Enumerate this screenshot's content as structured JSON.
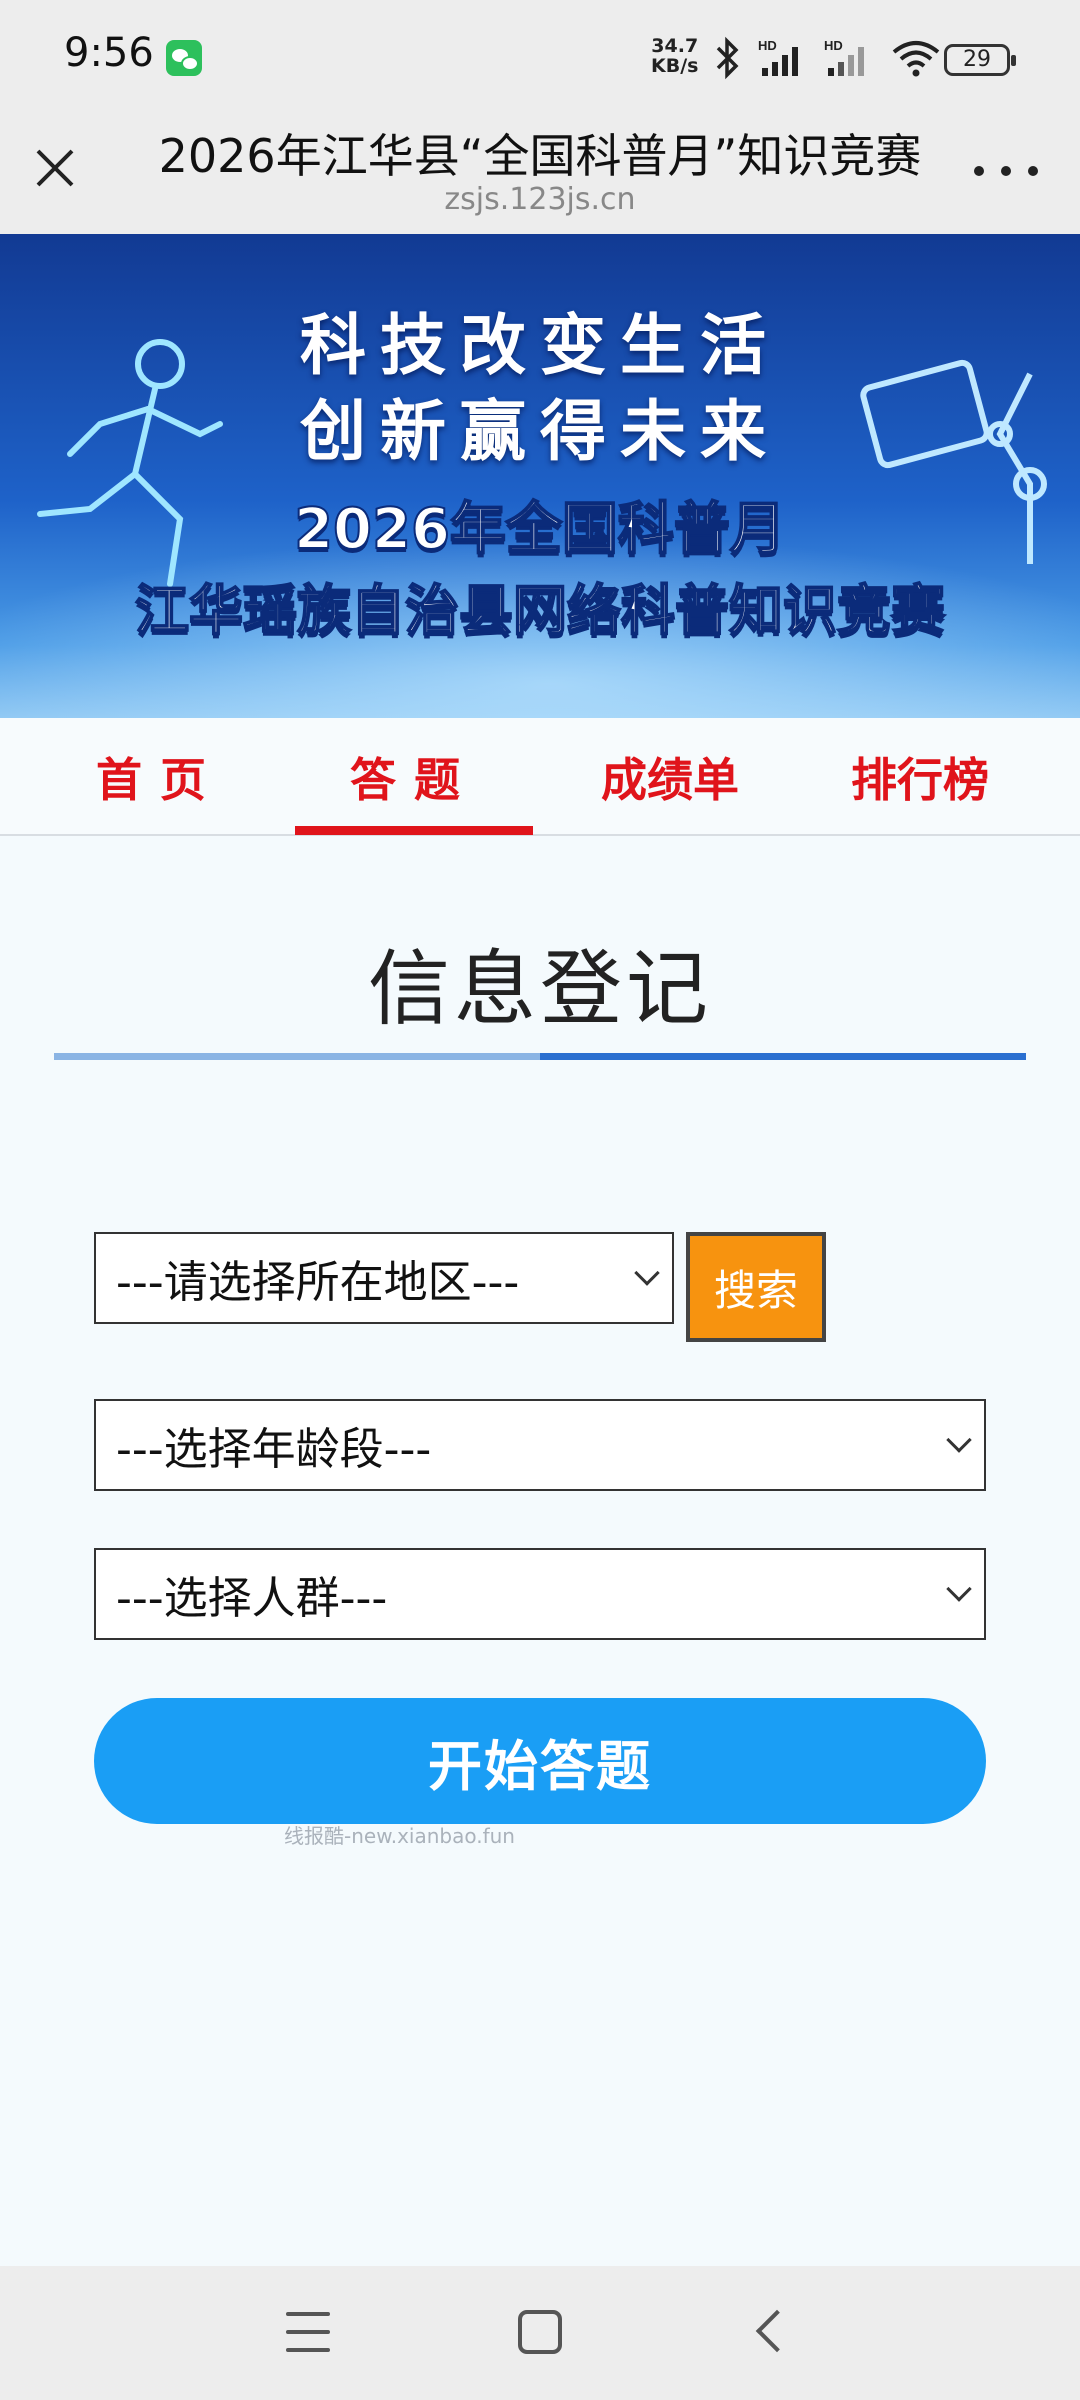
{
  "status_bar": {
    "time": "9:56",
    "net_speed_value": "34.7",
    "net_speed_unit": "KB/s",
    "battery": "29",
    "icons": [
      "wechat-icon",
      "bluetooth-icon",
      "signal-hd-icon",
      "signal-hd-icon",
      "wifi-icon",
      "battery-icon"
    ]
  },
  "title_bar": {
    "title": "2026年江华县“全国科普月”知识竞赛",
    "url": "zsjs.123js.cn",
    "close_icon": "close-icon",
    "more_icon": "more-icon"
  },
  "banner": {
    "slogan_line1": "科技改变生活",
    "slogan_line2": "创新赢得未来",
    "event_line1": "2026年全国科普月",
    "event_line2": "江华瑶族自治县网络科普知识竞赛"
  },
  "nav": {
    "tabs": [
      {
        "label": "首页",
        "active": false
      },
      {
        "label": "答题",
        "active": true
      },
      {
        "label": "成绩单",
        "active": false
      },
      {
        "label": "排行榜",
        "active": false
      }
    ],
    "active_color": "#e0141b"
  },
  "form": {
    "title": "信息登记",
    "region_select": "---请选择所在地区---",
    "search_label": "搜索",
    "age_select": "---选择年龄段---",
    "group_select": "---选择人群---",
    "start_label": "开始答题",
    "watermark": "线报酷-new.xianbao.fun"
  },
  "colors": {
    "accent_blue": "#1a9ef5",
    "search_orange": "#f7930f",
    "rule_light": "#8ab4e4",
    "rule_dark": "#2a6fd0"
  },
  "system_nav": {
    "icons": [
      "menu-icon",
      "home-icon",
      "back-icon"
    ]
  }
}
